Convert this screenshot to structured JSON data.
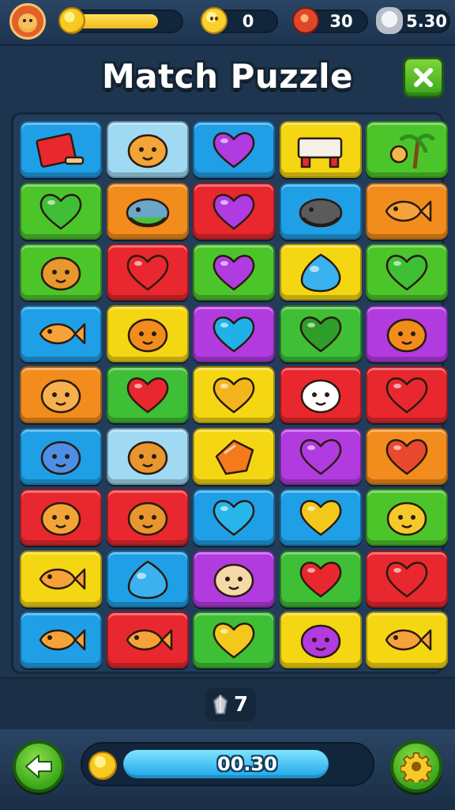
{
  "hud": {
    "xp_progress": 0.88,
    "smiles_count": "0",
    "ruby_count": "30",
    "timer_value": "5.30",
    "colors": {
      "xp_fill": "#f5b71b",
      "pill_bg": "#12263b"
    }
  },
  "title": {
    "text": "Match Puzzle"
  },
  "board": {
    "rows": 9,
    "cols": 5,
    "tiles": [
      [
        {
          "color": "#1f9fe6",
          "icon": "red-book-icon"
        },
        {
          "color": "#9fd9f2",
          "icon": "lion-icon"
        },
        {
          "color": "#1f9fe6",
          "icon": "heart-icon",
          "tint": "#b03be0"
        },
        {
          "color": "#f4d712",
          "icon": "desk-icon"
        },
        {
          "color": "#4cc52a",
          "icon": "island-icon"
        }
      ],
      [
        {
          "color": "#4cc52a",
          "icon": "heart-icon",
          "tint": "#3fbf35"
        },
        {
          "color": "#f28c1c",
          "icon": "seal-icon"
        },
        {
          "color": "#e8282e",
          "icon": "heart-icon",
          "tint": "#b03be0"
        },
        {
          "color": "#1f9fe6",
          "icon": "mole-icon"
        },
        {
          "color": "#f28c1c",
          "icon": "fish-tag-icon"
        }
      ],
      [
        {
          "color": "#4cc52a",
          "icon": "hamster-icon"
        },
        {
          "color": "#e8282e",
          "icon": "heart-icon",
          "tint": "#e8282e"
        },
        {
          "color": "#4cc52a",
          "icon": "heart-icon",
          "tint": "#b03be0"
        },
        {
          "color": "#f4d712",
          "icon": "blob-icon"
        },
        {
          "color": "#4cc52a",
          "icon": "heart-icon",
          "tint": "#3fbf35"
        }
      ],
      [
        {
          "color": "#1f9fe6",
          "icon": "fish-icon"
        },
        {
          "color": "#f4d712",
          "icon": "shell-icon"
        },
        {
          "color": "#b23be0",
          "icon": "heart-icon",
          "tint": "#1fb2e8"
        },
        {
          "color": "#3fbf35",
          "icon": "heart-icon",
          "tint": "#2e9d2a"
        },
        {
          "color": "#b23be0",
          "icon": "dino-icon"
        }
      ],
      [
        {
          "color": "#f28c1c",
          "icon": "bear-icon"
        },
        {
          "color": "#3fbf35",
          "icon": "heart-icon",
          "tint": "#e8282e"
        },
        {
          "color": "#f4d712",
          "icon": "heart-icon",
          "tint": "#f2b51c"
        },
        {
          "color": "#e8282e",
          "icon": "cat-icon"
        },
        {
          "color": "#e8282e",
          "icon": "heart-icon",
          "tint": "#e8282e"
        }
      ],
      [
        {
          "color": "#1f9fe6",
          "icon": "axolotl-icon"
        },
        {
          "color": "#9fd9f2",
          "icon": "hamster-icon"
        },
        {
          "color": "#f4d712",
          "icon": "diamond-icon"
        },
        {
          "color": "#b23be0",
          "icon": "heart-icon",
          "tint": "#b03be0"
        },
        {
          "color": "#f28c1c",
          "icon": "heart-icon",
          "tint": "#e8482e"
        }
      ],
      [
        {
          "color": "#e8282e",
          "icon": "lion-icon"
        },
        {
          "color": "#e8282e",
          "icon": "hamster-icon"
        },
        {
          "color": "#1f9fe6",
          "icon": "heart-icon",
          "tint": "#27b6ea"
        },
        {
          "color": "#1f9fe6",
          "icon": "heart-icon",
          "tint": "#f2c81c"
        },
        {
          "color": "#4cc52a",
          "icon": "duck-icon"
        }
      ],
      [
        {
          "color": "#f4d712",
          "icon": "fish-icon"
        },
        {
          "color": "#1f9fe6",
          "icon": "blob-icon"
        },
        {
          "color": "#b23be0",
          "icon": "hedgehog-icon"
        },
        {
          "color": "#3fbf35",
          "icon": "heart-icon",
          "tint": "#e8282e"
        },
        {
          "color": "#e8282e",
          "icon": "heart-icon",
          "tint": "#e8282e"
        }
      ],
      [
        {
          "color": "#1f9fe6",
          "icon": "fish-icon"
        },
        {
          "color": "#e8282e",
          "icon": "fish-icon"
        },
        {
          "color": "#3fbf35",
          "icon": "heart-icon",
          "tint": "#f2c81c"
        },
        {
          "color": "#f4d712",
          "icon": "hippo-icon"
        },
        {
          "color": "#f4d712",
          "icon": "fish-icon"
        }
      ]
    ]
  },
  "moves": {
    "icon": "gem-icon",
    "value": "7"
  },
  "bottom": {
    "back_icon": "arrow-left-icon",
    "settings_icon": "gear-icon",
    "timer_progress": 0.84,
    "timer_text": "00.30"
  }
}
